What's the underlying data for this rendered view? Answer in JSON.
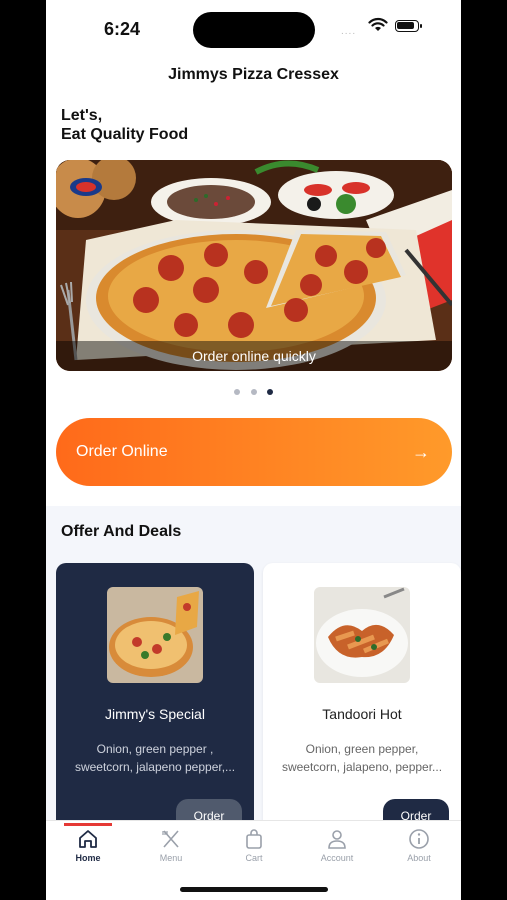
{
  "status_bar": {
    "time": "6:24",
    "signal": "...."
  },
  "header": {
    "title": "Jimmys Pizza Cressex"
  },
  "greeting": {
    "line1": "Let's,",
    "line2": "Eat Quality Food"
  },
  "banner": {
    "caption": "Order online quickly",
    "slide_count": 3,
    "active_slide": 3
  },
  "cta": {
    "label": "Order Online",
    "arrow": "→"
  },
  "offers": {
    "title": "Offer And Deals",
    "cards": [
      {
        "name": "Jimmy's Special",
        "desc_line1": "Onion, green pepper ,",
        "desc_line2": "sweetcorn, jalapeno pepper,...",
        "button": "Order"
      },
      {
        "name": "Tandoori Hot",
        "desc_line1": "Onion, green pepper,",
        "desc_line2": "sweetcorn, jalapeno, pepper...",
        "button": "Order"
      }
    ]
  },
  "tabs": [
    {
      "label": "Home",
      "icon": "home-icon",
      "active": true
    },
    {
      "label": "Menu",
      "icon": "cutlery-icon"
    },
    {
      "label": "Cart",
      "icon": "bag-icon"
    },
    {
      "label": "Account",
      "icon": "user-icon"
    },
    {
      "label": "About",
      "icon": "info-icon"
    }
  ],
  "colors": {
    "primary": "#1f2a44",
    "accent_start": "#ff6a1a",
    "accent_end": "#ff9a2a",
    "indicator": "#e53935"
  }
}
